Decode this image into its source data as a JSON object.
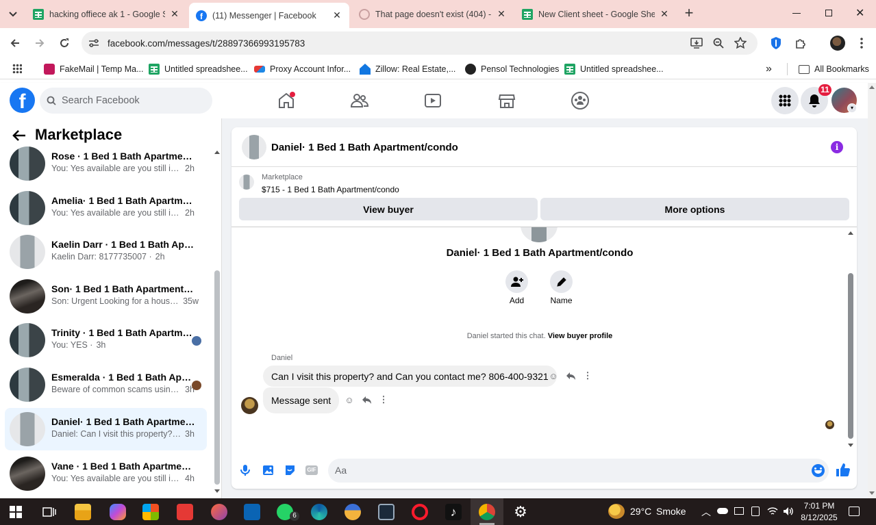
{
  "browser": {
    "tabs": [
      {
        "title": "hacking offiece ak 1 - Google Sh",
        "icon": "google-sheets-icon",
        "active": false
      },
      {
        "title": "(11) Messenger | Facebook",
        "icon": "facebook-icon",
        "active": true
      },
      {
        "title": "That page doesn't exist (404) - I",
        "icon": "broken-page-icon",
        "active": false
      },
      {
        "title": "New Client sheet - Google Shee",
        "icon": "google-sheets-icon",
        "active": false
      }
    ],
    "url": "facebook.com/messages/t/28897366993195783",
    "bookmarks": [
      {
        "label": "FakeMail | Temp Ma...",
        "icon": "fakemail-icon"
      },
      {
        "label": "Untitled spreadshee...",
        "icon": "google-sheets-icon"
      },
      {
        "label": "Proxy Account Infor...",
        "icon": "proxy-icon"
      },
      {
        "label": "Zillow: Real Estate,...",
        "icon": "zillow-icon"
      },
      {
        "label": "Pensol Technologies",
        "icon": "pensol-icon"
      },
      {
        "label": "Untitled spreadshee...",
        "icon": "google-sheets-icon"
      }
    ],
    "all_bookmarks": "All Bookmarks",
    "more_bookmarks": "»"
  },
  "facebook": {
    "search_placeholder": "Search Facebook",
    "notifications_count": "11",
    "brand_color": "#1877f2"
  },
  "sidebar": {
    "title": "Marketplace",
    "conversations": [
      {
        "name": "Rose · 1 Bed 1 Bath Apartment/c...",
        "snippet": "You: Yes available are you still inter...",
        "time": "2h",
        "selected": false
      },
      {
        "name": "Amelia· 1 Bed 1 Bath Apartment...",
        "snippet": "You: Yes available are you still inter...",
        "time": "2h",
        "selected": false
      },
      {
        "name": "Kaelin Darr · 1 Bed 1 Bath Apart...",
        "snippet": "Kaelin Darr: 8177735007 ·",
        "time": "2h",
        "selected": false
      },
      {
        "name": "Son· 1 Bed 1 Bath Apartment/co...",
        "snippet": "Son: Urgent Looking for a house ...",
        "time": "35w",
        "selected": false
      },
      {
        "name": "Trinity · 1 Bed 1 Bath Apartme...",
        "snippet": "You: YES ·",
        "time": "3h",
        "selected": false
      },
      {
        "name": "Esmeralda · 1 Bed 1 Bath Apar...",
        "snippet": "Beware of common scams using... ·",
        "time": "3h",
        "selected": false
      },
      {
        "name": "Daniel· 1 Bed 1 Bath Apartment/...",
        "snippet": "Daniel: Can I visit this property? an... ·",
        "time": "3h",
        "selected": true
      },
      {
        "name": "Vane · 1 Bed 1 Bath Apartment/c...",
        "snippet": "You: Yes available are you still inter...",
        "time": "4h",
        "selected": false
      }
    ]
  },
  "chat": {
    "header_title": "Daniel· 1 Bed 1 Bath Apartment/condo",
    "listing_label": "Marketplace",
    "listing_detail": "$715 - 1 Bed 1 Bath Apartment/condo",
    "view_buyer": "View buyer",
    "more_options": "More options",
    "profile_name": "Daniel· 1 Bed 1 Bath Apartment/condo",
    "add_label": "Add",
    "name_label": "Name",
    "started_text": "Daniel started this chat.",
    "view_buyer_profile": "View buyer profile",
    "sender_name": "Daniel",
    "messages": [
      {
        "text": "Can I visit this property? and Can you contact me? 806-400-9321"
      },
      {
        "text": "Message sent"
      }
    ],
    "composer_placeholder": "Aa"
  },
  "taskbar": {
    "weather_temp": "29°C",
    "weather_desc": "Smoke",
    "time": "7:01 PM",
    "date": "8/12/2025",
    "whatsapp_badge": "6"
  }
}
